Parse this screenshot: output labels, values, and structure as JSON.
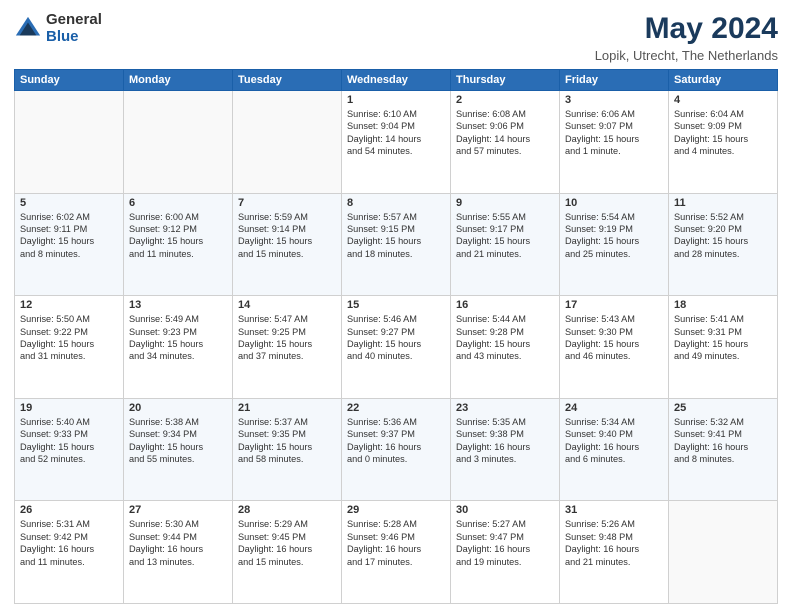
{
  "header": {
    "logo_general": "General",
    "logo_blue": "Blue",
    "title": "May 2024",
    "subtitle": "Lopik, Utrecht, The Netherlands"
  },
  "days_of_week": [
    "Sunday",
    "Monday",
    "Tuesday",
    "Wednesday",
    "Thursday",
    "Friday",
    "Saturday"
  ],
  "weeks": [
    [
      {
        "day": "",
        "info": ""
      },
      {
        "day": "",
        "info": ""
      },
      {
        "day": "",
        "info": ""
      },
      {
        "day": "1",
        "info": "Sunrise: 6:10 AM\nSunset: 9:04 PM\nDaylight: 14 hours\nand 54 minutes."
      },
      {
        "day": "2",
        "info": "Sunrise: 6:08 AM\nSunset: 9:06 PM\nDaylight: 14 hours\nand 57 minutes."
      },
      {
        "day": "3",
        "info": "Sunrise: 6:06 AM\nSunset: 9:07 PM\nDaylight: 15 hours\nand 1 minute."
      },
      {
        "day": "4",
        "info": "Sunrise: 6:04 AM\nSunset: 9:09 PM\nDaylight: 15 hours\nand 4 minutes."
      }
    ],
    [
      {
        "day": "5",
        "info": "Sunrise: 6:02 AM\nSunset: 9:11 PM\nDaylight: 15 hours\nand 8 minutes."
      },
      {
        "day": "6",
        "info": "Sunrise: 6:00 AM\nSunset: 9:12 PM\nDaylight: 15 hours\nand 11 minutes."
      },
      {
        "day": "7",
        "info": "Sunrise: 5:59 AM\nSunset: 9:14 PM\nDaylight: 15 hours\nand 15 minutes."
      },
      {
        "day": "8",
        "info": "Sunrise: 5:57 AM\nSunset: 9:15 PM\nDaylight: 15 hours\nand 18 minutes."
      },
      {
        "day": "9",
        "info": "Sunrise: 5:55 AM\nSunset: 9:17 PM\nDaylight: 15 hours\nand 21 minutes."
      },
      {
        "day": "10",
        "info": "Sunrise: 5:54 AM\nSunset: 9:19 PM\nDaylight: 15 hours\nand 25 minutes."
      },
      {
        "day": "11",
        "info": "Sunrise: 5:52 AM\nSunset: 9:20 PM\nDaylight: 15 hours\nand 28 minutes."
      }
    ],
    [
      {
        "day": "12",
        "info": "Sunrise: 5:50 AM\nSunset: 9:22 PM\nDaylight: 15 hours\nand 31 minutes."
      },
      {
        "day": "13",
        "info": "Sunrise: 5:49 AM\nSunset: 9:23 PM\nDaylight: 15 hours\nand 34 minutes."
      },
      {
        "day": "14",
        "info": "Sunrise: 5:47 AM\nSunset: 9:25 PM\nDaylight: 15 hours\nand 37 minutes."
      },
      {
        "day": "15",
        "info": "Sunrise: 5:46 AM\nSunset: 9:27 PM\nDaylight: 15 hours\nand 40 minutes."
      },
      {
        "day": "16",
        "info": "Sunrise: 5:44 AM\nSunset: 9:28 PM\nDaylight: 15 hours\nand 43 minutes."
      },
      {
        "day": "17",
        "info": "Sunrise: 5:43 AM\nSunset: 9:30 PM\nDaylight: 15 hours\nand 46 minutes."
      },
      {
        "day": "18",
        "info": "Sunrise: 5:41 AM\nSunset: 9:31 PM\nDaylight: 15 hours\nand 49 minutes."
      }
    ],
    [
      {
        "day": "19",
        "info": "Sunrise: 5:40 AM\nSunset: 9:33 PM\nDaylight: 15 hours\nand 52 minutes."
      },
      {
        "day": "20",
        "info": "Sunrise: 5:38 AM\nSunset: 9:34 PM\nDaylight: 15 hours\nand 55 minutes."
      },
      {
        "day": "21",
        "info": "Sunrise: 5:37 AM\nSunset: 9:35 PM\nDaylight: 15 hours\nand 58 minutes."
      },
      {
        "day": "22",
        "info": "Sunrise: 5:36 AM\nSunset: 9:37 PM\nDaylight: 16 hours\nand 0 minutes."
      },
      {
        "day": "23",
        "info": "Sunrise: 5:35 AM\nSunset: 9:38 PM\nDaylight: 16 hours\nand 3 minutes."
      },
      {
        "day": "24",
        "info": "Sunrise: 5:34 AM\nSunset: 9:40 PM\nDaylight: 16 hours\nand 6 minutes."
      },
      {
        "day": "25",
        "info": "Sunrise: 5:32 AM\nSunset: 9:41 PM\nDaylight: 16 hours\nand 8 minutes."
      }
    ],
    [
      {
        "day": "26",
        "info": "Sunrise: 5:31 AM\nSunset: 9:42 PM\nDaylight: 16 hours\nand 11 minutes."
      },
      {
        "day": "27",
        "info": "Sunrise: 5:30 AM\nSunset: 9:44 PM\nDaylight: 16 hours\nand 13 minutes."
      },
      {
        "day": "28",
        "info": "Sunrise: 5:29 AM\nSunset: 9:45 PM\nDaylight: 16 hours\nand 15 minutes."
      },
      {
        "day": "29",
        "info": "Sunrise: 5:28 AM\nSunset: 9:46 PM\nDaylight: 16 hours\nand 17 minutes."
      },
      {
        "day": "30",
        "info": "Sunrise: 5:27 AM\nSunset: 9:47 PM\nDaylight: 16 hours\nand 19 minutes."
      },
      {
        "day": "31",
        "info": "Sunrise: 5:26 AM\nSunset: 9:48 PM\nDaylight: 16 hours\nand 21 minutes."
      },
      {
        "day": "",
        "info": ""
      }
    ]
  ]
}
